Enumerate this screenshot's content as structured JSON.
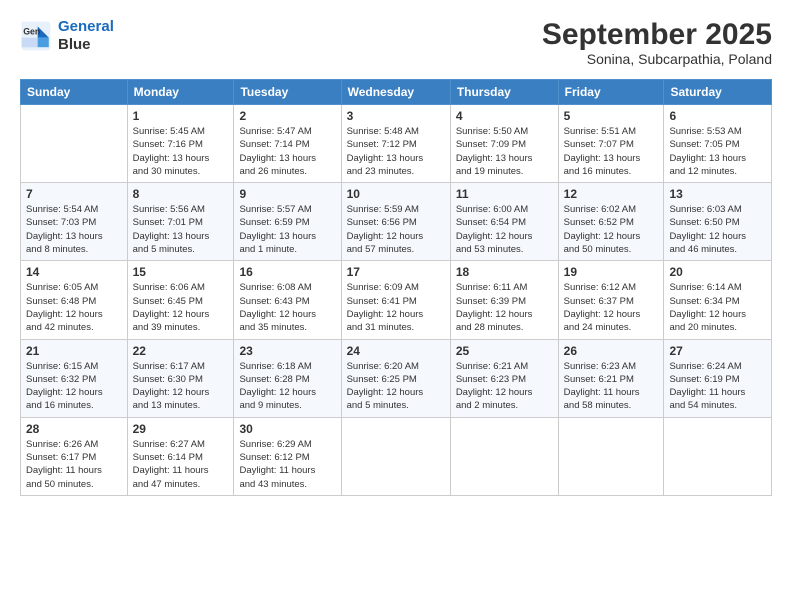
{
  "header": {
    "logo_line1": "General",
    "logo_line2": "Blue",
    "title": "September 2025",
    "subtitle": "Sonina, Subcarpathia, Poland"
  },
  "weekdays": [
    "Sunday",
    "Monday",
    "Tuesday",
    "Wednesday",
    "Thursday",
    "Friday",
    "Saturday"
  ],
  "weeks": [
    [
      {
        "day": "",
        "info": ""
      },
      {
        "day": "1",
        "info": "Sunrise: 5:45 AM\nSunset: 7:16 PM\nDaylight: 13 hours\nand 30 minutes."
      },
      {
        "day": "2",
        "info": "Sunrise: 5:47 AM\nSunset: 7:14 PM\nDaylight: 13 hours\nand 26 minutes."
      },
      {
        "day": "3",
        "info": "Sunrise: 5:48 AM\nSunset: 7:12 PM\nDaylight: 13 hours\nand 23 minutes."
      },
      {
        "day": "4",
        "info": "Sunrise: 5:50 AM\nSunset: 7:09 PM\nDaylight: 13 hours\nand 19 minutes."
      },
      {
        "day": "5",
        "info": "Sunrise: 5:51 AM\nSunset: 7:07 PM\nDaylight: 13 hours\nand 16 minutes."
      },
      {
        "day": "6",
        "info": "Sunrise: 5:53 AM\nSunset: 7:05 PM\nDaylight: 13 hours\nand 12 minutes."
      }
    ],
    [
      {
        "day": "7",
        "info": "Sunrise: 5:54 AM\nSunset: 7:03 PM\nDaylight: 13 hours\nand 8 minutes."
      },
      {
        "day": "8",
        "info": "Sunrise: 5:56 AM\nSunset: 7:01 PM\nDaylight: 13 hours\nand 5 minutes."
      },
      {
        "day": "9",
        "info": "Sunrise: 5:57 AM\nSunset: 6:59 PM\nDaylight: 13 hours\nand 1 minute."
      },
      {
        "day": "10",
        "info": "Sunrise: 5:59 AM\nSunset: 6:56 PM\nDaylight: 12 hours\nand 57 minutes."
      },
      {
        "day": "11",
        "info": "Sunrise: 6:00 AM\nSunset: 6:54 PM\nDaylight: 12 hours\nand 53 minutes."
      },
      {
        "day": "12",
        "info": "Sunrise: 6:02 AM\nSunset: 6:52 PM\nDaylight: 12 hours\nand 50 minutes."
      },
      {
        "day": "13",
        "info": "Sunrise: 6:03 AM\nSunset: 6:50 PM\nDaylight: 12 hours\nand 46 minutes."
      }
    ],
    [
      {
        "day": "14",
        "info": "Sunrise: 6:05 AM\nSunset: 6:48 PM\nDaylight: 12 hours\nand 42 minutes."
      },
      {
        "day": "15",
        "info": "Sunrise: 6:06 AM\nSunset: 6:45 PM\nDaylight: 12 hours\nand 39 minutes."
      },
      {
        "day": "16",
        "info": "Sunrise: 6:08 AM\nSunset: 6:43 PM\nDaylight: 12 hours\nand 35 minutes."
      },
      {
        "day": "17",
        "info": "Sunrise: 6:09 AM\nSunset: 6:41 PM\nDaylight: 12 hours\nand 31 minutes."
      },
      {
        "day": "18",
        "info": "Sunrise: 6:11 AM\nSunset: 6:39 PM\nDaylight: 12 hours\nand 28 minutes."
      },
      {
        "day": "19",
        "info": "Sunrise: 6:12 AM\nSunset: 6:37 PM\nDaylight: 12 hours\nand 24 minutes."
      },
      {
        "day": "20",
        "info": "Sunrise: 6:14 AM\nSunset: 6:34 PM\nDaylight: 12 hours\nand 20 minutes."
      }
    ],
    [
      {
        "day": "21",
        "info": "Sunrise: 6:15 AM\nSunset: 6:32 PM\nDaylight: 12 hours\nand 16 minutes."
      },
      {
        "day": "22",
        "info": "Sunrise: 6:17 AM\nSunset: 6:30 PM\nDaylight: 12 hours\nand 13 minutes."
      },
      {
        "day": "23",
        "info": "Sunrise: 6:18 AM\nSunset: 6:28 PM\nDaylight: 12 hours\nand 9 minutes."
      },
      {
        "day": "24",
        "info": "Sunrise: 6:20 AM\nSunset: 6:25 PM\nDaylight: 12 hours\nand 5 minutes."
      },
      {
        "day": "25",
        "info": "Sunrise: 6:21 AM\nSunset: 6:23 PM\nDaylight: 12 hours\nand 2 minutes."
      },
      {
        "day": "26",
        "info": "Sunrise: 6:23 AM\nSunset: 6:21 PM\nDaylight: 11 hours\nand 58 minutes."
      },
      {
        "day": "27",
        "info": "Sunrise: 6:24 AM\nSunset: 6:19 PM\nDaylight: 11 hours\nand 54 minutes."
      }
    ],
    [
      {
        "day": "28",
        "info": "Sunrise: 6:26 AM\nSunset: 6:17 PM\nDaylight: 11 hours\nand 50 minutes."
      },
      {
        "day": "29",
        "info": "Sunrise: 6:27 AM\nSunset: 6:14 PM\nDaylight: 11 hours\nand 47 minutes."
      },
      {
        "day": "30",
        "info": "Sunrise: 6:29 AM\nSunset: 6:12 PM\nDaylight: 11 hours\nand 43 minutes."
      },
      {
        "day": "",
        "info": ""
      },
      {
        "day": "",
        "info": ""
      },
      {
        "day": "",
        "info": ""
      },
      {
        "day": "",
        "info": ""
      }
    ]
  ]
}
